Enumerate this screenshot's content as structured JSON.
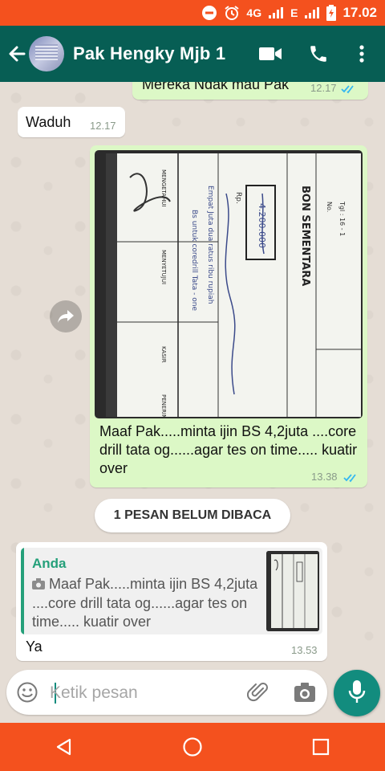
{
  "status_bar": {
    "network": "4G",
    "network2": "E",
    "time": "17.02"
  },
  "header": {
    "title": "Pak Hengky Mjb 1",
    "icons": [
      "back-arrow-icon",
      "avatar",
      "video-call-icon",
      "phone-icon",
      "more-vert-icon"
    ]
  },
  "messages": {
    "m1": {
      "text": "Mereka Ndak mau Pak",
      "time": "12.17"
    },
    "m2": {
      "text": "Waduh",
      "time": "12.17"
    },
    "m3": {
      "doc_header": "BON SEMENTARA",
      "doc_amount": "4.200.000",
      "doc_no": "No.",
      "doc_tgl": "Tgl : 16 - 1",
      "doc_rp": "Rp.",
      "doc_labels": [
        "MENGETAHUI",
        "MENYETUJUI",
        "KASIR",
        "PENERIMA"
      ],
      "doc_handwriting": "Empat Juta dua ratus ribu rupiah",
      "doc_handwriting2": "Bs untuk coredrill Tata - one",
      "caption": "Maaf Pak.....minta ijin BS 4,2juta ....core drill tata og......agar tes on time..... kuatir over",
      "time": "13.38"
    },
    "unread_banner": "1 PESAN BELUM DIBACA",
    "m4": {
      "quote_author": "Anda",
      "quote_text": "Maaf Pak.....minta ijin BS 4,2juta ....core drill tata og......agar tes on time..... kuatir over",
      "text": "Ya",
      "time": "13.53"
    }
  },
  "composer": {
    "placeholder": "Ketik pesan"
  },
  "colors": {
    "status_bar": "#f4511e",
    "app_bar": "#075e54",
    "outgoing_bubble": "#dcf8c6",
    "incoming_bubble": "#ffffff",
    "accent": "#128c7e",
    "read_ticks": "#34b7f1"
  }
}
